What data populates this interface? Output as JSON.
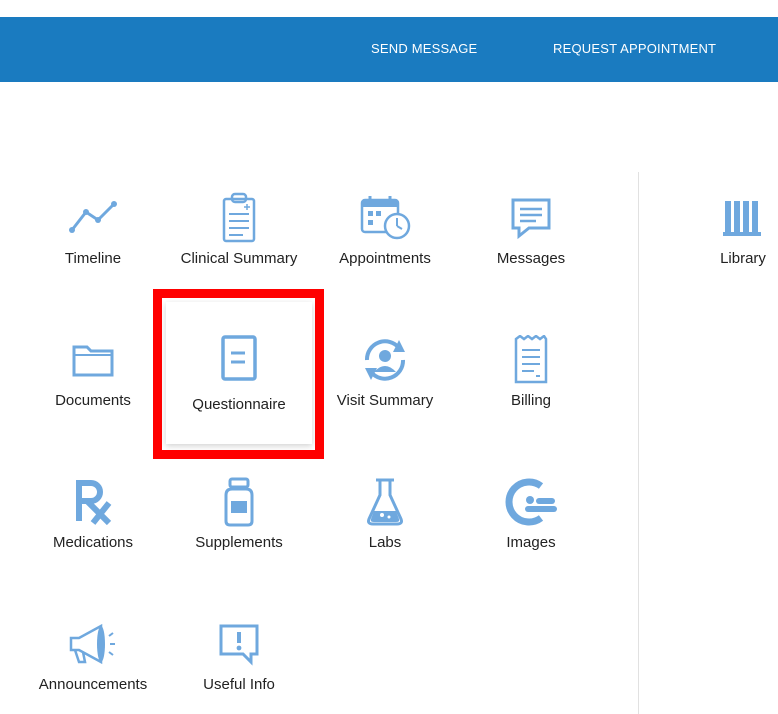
{
  "header": {
    "send_message": "SEND MESSAGE",
    "request_appointment": "REQUEST APPOINTMENT"
  },
  "colors": {
    "header_bg": "#1a7bc0",
    "icon": "#6fa8de",
    "highlight": "#ff0000"
  },
  "tiles": [
    {
      "label": "Timeline",
      "icon": "timeline-icon"
    },
    {
      "label": "Clinical Summary",
      "icon": "clipboard-icon"
    },
    {
      "label": "Appointments",
      "icon": "calendar-clock-icon"
    },
    {
      "label": "Messages",
      "icon": "message-icon"
    },
    {
      "label": "Documents",
      "icon": "folder-icon"
    },
    {
      "label": "Questionnaire",
      "icon": "document-icon",
      "selected": true
    },
    {
      "label": "Visit Summary",
      "icon": "user-refresh-icon"
    },
    {
      "label": "Billing",
      "icon": "receipt-icon"
    },
    {
      "label": "Medications",
      "icon": "rx-icon"
    },
    {
      "label": "Supplements",
      "icon": "bottle-icon"
    },
    {
      "label": "Labs",
      "icon": "flask-icon"
    },
    {
      "label": "Images",
      "icon": "scan-icon"
    },
    {
      "label": "Announcements",
      "icon": "megaphone-icon"
    },
    {
      "label": "Useful Info",
      "icon": "info-bubble-icon"
    }
  ],
  "side_tiles": [
    {
      "label": "Library",
      "icon": "library-icon"
    }
  ]
}
